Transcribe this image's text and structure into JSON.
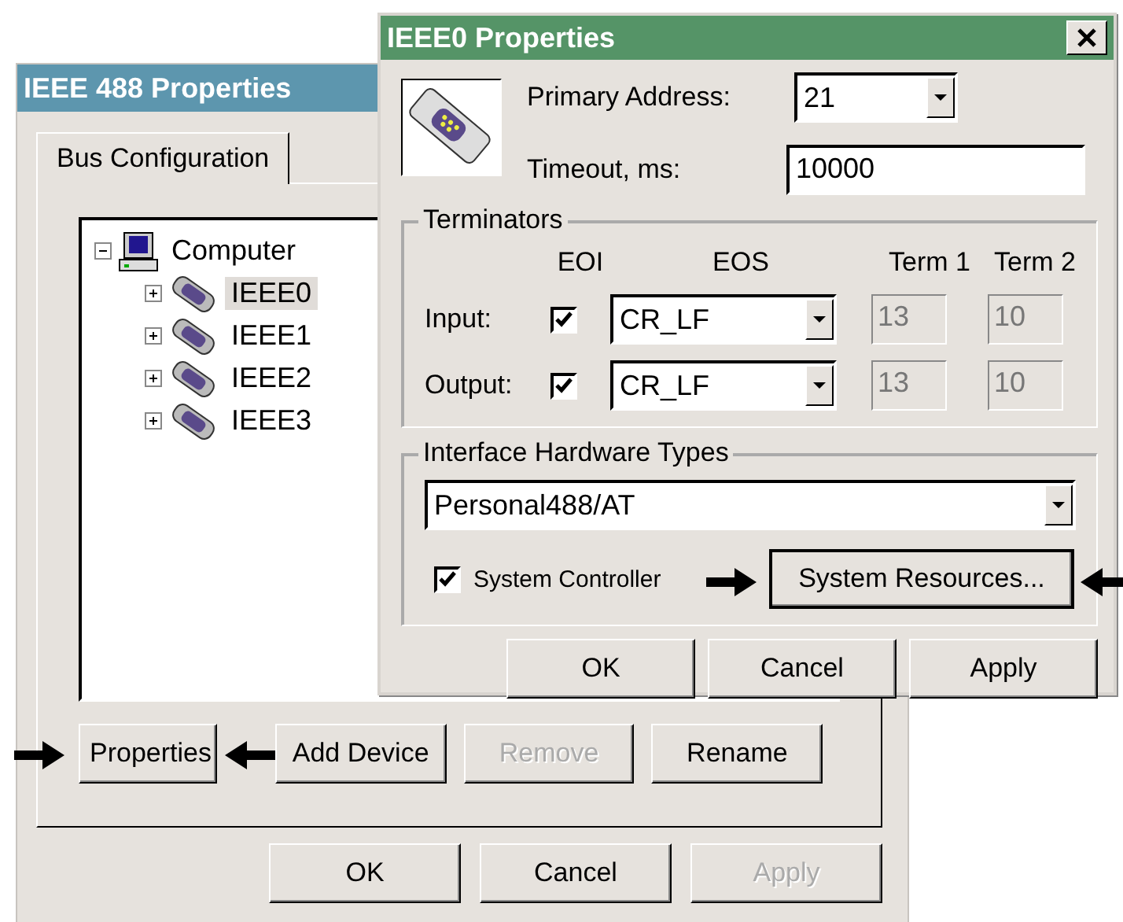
{
  "back_window": {
    "title": "IEEE 488 Properties",
    "tabs": [
      {
        "label": "Bus Configuration",
        "selected": true
      }
    ],
    "tree": [
      {
        "label": "Computer",
        "kind": "computer",
        "expanded": true,
        "selected": false,
        "children": [
          {
            "label": "IEEE0",
            "kind": "device",
            "expanded": false,
            "selected": true
          },
          {
            "label": "IEEE1",
            "kind": "device",
            "expanded": false,
            "selected": false
          },
          {
            "label": "IEEE2",
            "kind": "device",
            "expanded": false,
            "selected": false
          },
          {
            "label": "IEEE3",
            "kind": "device",
            "expanded": false,
            "selected": false
          }
        ]
      }
    ],
    "buttons": [
      {
        "label": "Properties",
        "disabled": false,
        "pointed": true
      },
      {
        "label": "Add Device",
        "disabled": false,
        "pointed": false
      },
      {
        "label": "Remove",
        "disabled": true,
        "pointed": false
      },
      {
        "label": "Rename",
        "disabled": false,
        "pointed": false
      }
    ],
    "dialog_buttons": [
      {
        "label": "OK",
        "disabled": false
      },
      {
        "label": "Cancel",
        "disabled": false
      },
      {
        "label": "Apply",
        "disabled": true
      }
    ]
  },
  "front_window": {
    "title": "IEEE0 Properties",
    "primary_address": {
      "label": "Primary Address:",
      "value": "21"
    },
    "timeout": {
      "label": "Timeout, ms:",
      "value": "10000"
    },
    "terminators": {
      "title": "Terminators",
      "columns": [
        "EOI",
        "EOS",
        "Term 1",
        "Term 2"
      ],
      "rows": [
        {
          "label": "Input:",
          "eoi_checked": true,
          "eos": "CR_LF",
          "term_1": "13",
          "term_2": "10",
          "terms_disabled": true
        },
        {
          "label": "Output:",
          "eoi_checked": true,
          "eos": "CR_LF",
          "term_1": "13",
          "term_2": "10",
          "terms_disabled": true
        }
      ]
    },
    "hardware": {
      "title": "Interface Hardware Types",
      "type": "Personal488/AT",
      "system_controller": {
        "label": "System Controller",
        "checked": true
      },
      "resources_button": {
        "label": "System Resources...",
        "pointed": true
      }
    },
    "buttons": [
      {
        "label": "OK",
        "disabled": false
      },
      {
        "label": "Cancel",
        "disabled": false
      },
      {
        "label": "Apply",
        "disabled": false
      }
    ]
  }
}
